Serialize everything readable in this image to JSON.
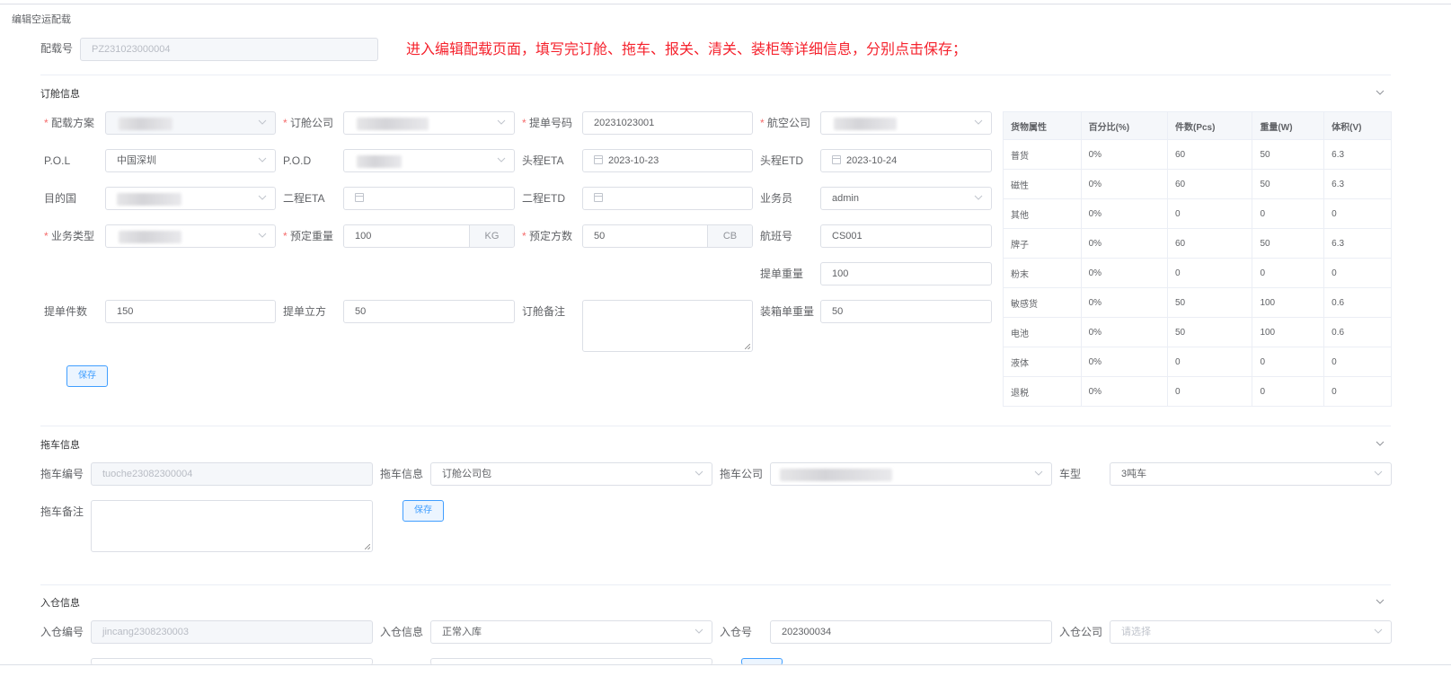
{
  "breadcrumb": "编辑空运配载",
  "notice": "进入编辑配载页面，填写完订舱、拖车、报关、清关、装柜等详细信息，分别点击保存；",
  "peizai": {
    "label": "配载号",
    "value": "PZ231023000004"
  },
  "booking": {
    "title": "订舱信息",
    "scheme_label": "配载方案",
    "company_label": "订舱公司",
    "bill_no_label": "提单号码",
    "bill_no_value": "20231023001",
    "airline_label": "航空公司",
    "pol_label": "P.O.L",
    "pol_value": "中国深圳",
    "pod_label": "P.O.D",
    "eta1_label": "头程ETA",
    "eta1_value": "2023-10-23",
    "etd1_label": "头程ETD",
    "etd1_value": "2023-10-24",
    "dest_label": "目的国",
    "eta2_label": "二程ETA",
    "etd2_label": "二程ETD",
    "salesman_label": "业务员",
    "salesman_value": "admin",
    "biz_type_label": "业务类型",
    "weight_label": "预定重量",
    "weight_value": "100",
    "weight_unit": "KG",
    "volume_label": "预定方数",
    "volume_value": "50",
    "volume_unit": "CB",
    "flight_label": "航班号",
    "flight_value": "CS001",
    "bill_weight_label": "提单重量",
    "bill_weight_value": "100",
    "bill_pcs_label": "提单件数",
    "bill_pcs_value": "150",
    "bill_cbm_label": "提单立方",
    "bill_cbm_value": "50",
    "remark_label": "订舱备注",
    "pack_weight_label": "装箱单重量",
    "pack_weight_value": "50",
    "save_label": "保存"
  },
  "cargo_table": {
    "headers": [
      "货物属性",
      "百分比(%)",
      "件数(Pcs)",
      "重量(W)",
      "体积(V)"
    ],
    "rows": [
      [
        "普货",
        "0%",
        "60",
        "50",
        "6.3"
      ],
      [
        "磁性",
        "0%",
        "60",
        "50",
        "6.3"
      ],
      [
        "其他",
        "0%",
        "0",
        "0",
        "0"
      ],
      [
        "牌子",
        "0%",
        "60",
        "50",
        "6.3"
      ],
      [
        "粉末",
        "0%",
        "0",
        "0",
        "0"
      ],
      [
        "敏感货",
        "0%",
        "50",
        "100",
        "0.6"
      ],
      [
        "电池",
        "0%",
        "50",
        "100",
        "0.6"
      ],
      [
        "液体",
        "0%",
        "0",
        "0",
        "0"
      ],
      [
        "退税",
        "0%",
        "0",
        "0",
        "0"
      ]
    ]
  },
  "truck": {
    "title": "拖车信息",
    "no_label": "拖车编号",
    "no_value": "tuoche23082300004",
    "info_label": "拖车信息",
    "info_value": "订舱公司包",
    "company_label": "拖车公司",
    "type_label": "车型",
    "type_value": "3吨车",
    "remark_label": "拖车备注",
    "save_label": "保存"
  },
  "warehouse": {
    "title": "入仓信息",
    "no_label": "入仓编号",
    "no_value": "jincang2308230003",
    "info_label": "入仓信息",
    "info_value": "正常入库",
    "wh_no_label": "入仓号",
    "wh_no_value": "202300034",
    "company_label": "入仓公司",
    "company_placeholder": "请选择"
  }
}
